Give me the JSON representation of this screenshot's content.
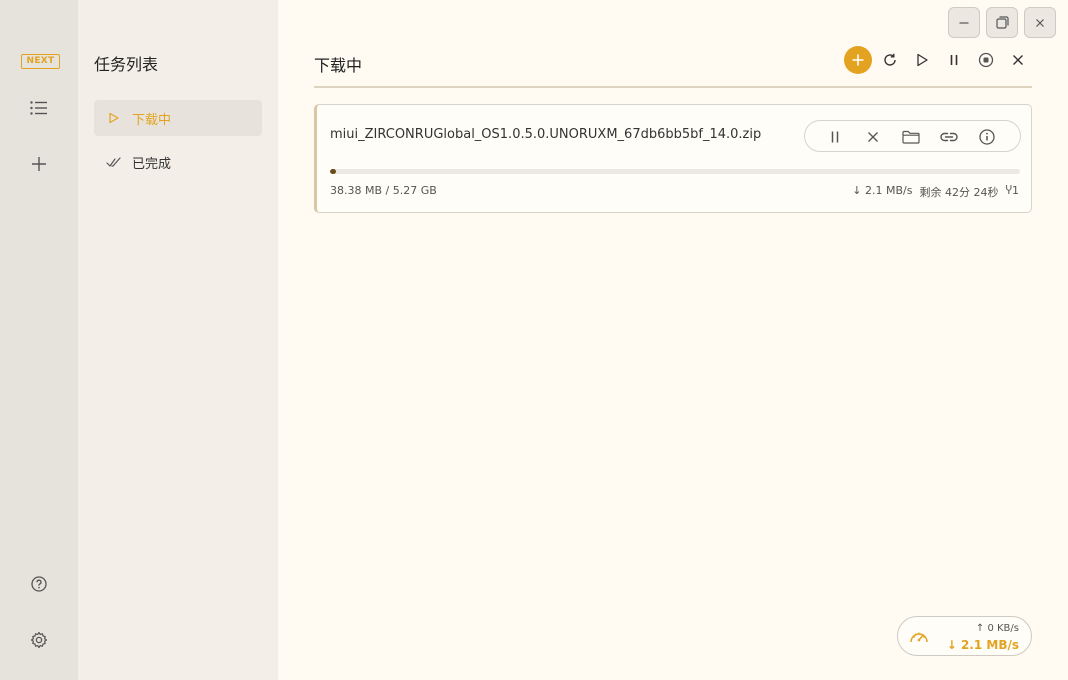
{
  "app": {
    "logo_text": "NEXT"
  },
  "rail": {
    "items": [
      "list-icon",
      "plus-icon"
    ],
    "bottom_items": [
      "help-icon",
      "gear-icon"
    ]
  },
  "panel": {
    "title": "任务列表",
    "items": [
      {
        "label": "下载中",
        "icon": "play-outline-icon",
        "active": true
      },
      {
        "label": "已完成",
        "icon": "double-check-icon",
        "active": false
      }
    ]
  },
  "window_controls": [
    "minimize-icon",
    "restore-icon",
    "close-icon"
  ],
  "main": {
    "title": "下载中",
    "toolbar": [
      "add-icon",
      "refresh-icon",
      "resume-all-icon",
      "pause-all-icon",
      "stop-icon",
      "delete-icon"
    ]
  },
  "task": {
    "filename": "miui_ZIRCONRUGlobal_OS1.0.5.0.UNORUXM_67db6bb5bf_14.0.zip",
    "size": "38.38 MB / 5.27 GB",
    "progress_percent": 0.7,
    "speed": "2.1 MB/s",
    "remaining": "剩余 42分 24秒",
    "connections": "1",
    "actions": [
      "pause-icon",
      "remove-icon",
      "folder-icon",
      "link-icon",
      "info-icon"
    ]
  },
  "speed_widget": {
    "upload": "0 KB/s",
    "download": "2.1 MB/s"
  },
  "colors": {
    "accent": "#e3a321",
    "rail_bg": "#e6e2dc",
    "panel_bg": "#f3efe8",
    "main_bg": "#fffaf2"
  }
}
